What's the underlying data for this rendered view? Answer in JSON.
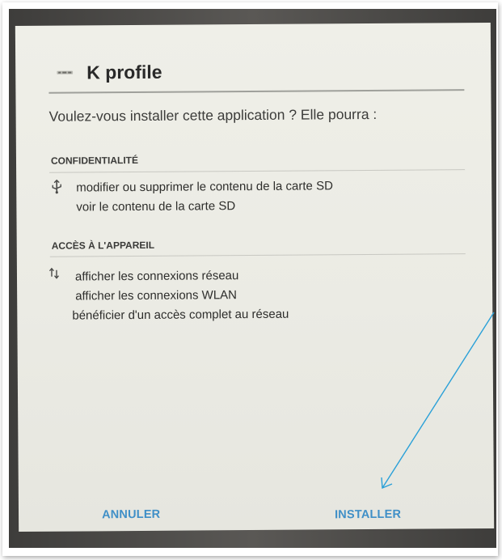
{
  "dialog": {
    "app_name": "K profile",
    "app_icon_name": "k-profile-app-icon",
    "prompt": "Voulez-vous installer cette application ? Elle pourra :",
    "sections": [
      {
        "header": "CONFIDENTIALITÉ",
        "icon": "usb-icon",
        "items": [
          "modifier ou supprimer le contenu de la carte SD",
          "voir le contenu de la carte SD"
        ]
      },
      {
        "header": "ACCÈS À L'APPAREIL",
        "icon": "network-arrows-icon",
        "items": [
          "afficher les connexions réseau",
          "afficher les connexions WLAN",
          "bénéficier d'un accès complet au réseau"
        ]
      }
    ],
    "buttons": {
      "cancel": "ANNULER",
      "install": "INSTALLER"
    }
  },
  "colors": {
    "button_text": "#3f8fc7",
    "annotation_arrow": "#2aa0d8",
    "screen_background": "#ecece5"
  }
}
